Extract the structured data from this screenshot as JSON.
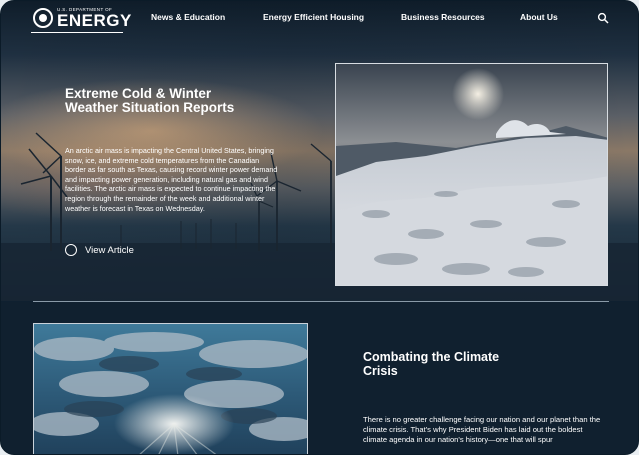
{
  "header": {
    "logo": {
      "subtitle": "U.S. DEPARTMENT OF",
      "title": "ENERGY"
    },
    "nav": [
      {
        "label": "News & Education"
      },
      {
        "label": "Energy Efficient Housing"
      },
      {
        "label": "Business Resources"
      },
      {
        "label": "About Us"
      }
    ],
    "search_icon": "search-icon"
  },
  "hero": {
    "title": "Extreme Cold & Winter Weather Situation Reports",
    "description": "An arctic air mass is impacting the Central United States, bringing snow, ice, and extreme cold temperatures from the Canadian border as far south as Texas, causing record winter power demand and impacting power generation, including natural gas and wind facilities. The arctic air mass is expected to continue impacting the region through the remainder of the week and additional winter weather is forecast in Texas on Wednesday.",
    "cta_label": "View Article"
  },
  "climate": {
    "title": "Combating the Climate Crisis",
    "description": "There is no greater challenge facing our nation and our planet than the climate crisis. That's why President Biden has laid out the boldest climate agenda in our nation's history—one that will spur"
  },
  "colors": {
    "background": "#0f2030",
    "text": "#ffffff",
    "divider": "#8a9aa8"
  }
}
